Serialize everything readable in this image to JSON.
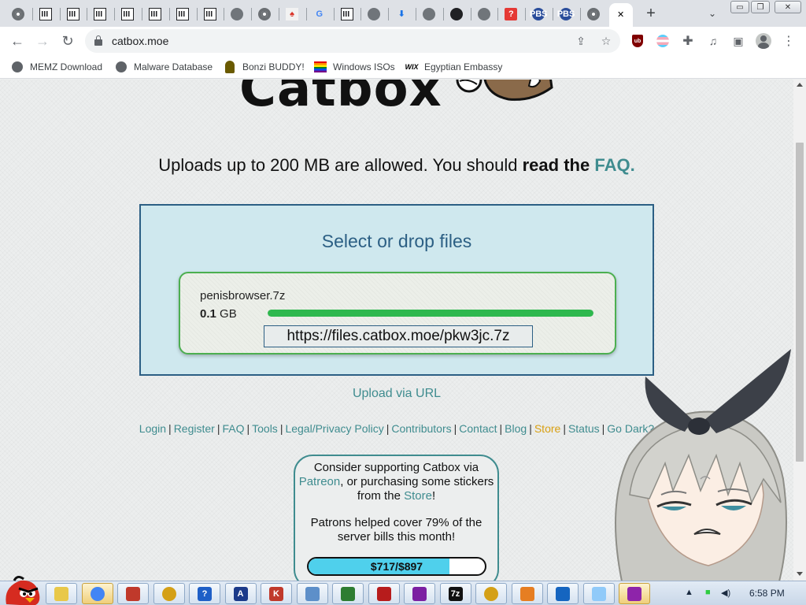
{
  "browser": {
    "tabs": [
      {
        "icon": "chrome-icon"
      },
      {
        "icon": "archive-icon"
      },
      {
        "icon": "archive-icon"
      },
      {
        "icon": "archive-icon"
      },
      {
        "icon": "archive-icon"
      },
      {
        "icon": "archive-icon"
      },
      {
        "icon": "archive-icon"
      },
      {
        "icon": "archive-icon"
      },
      {
        "icon": "globe-icon"
      },
      {
        "icon": "chrome-icon"
      },
      {
        "icon": "red-site-icon"
      },
      {
        "icon": "google-icon"
      },
      {
        "icon": "archive-icon"
      },
      {
        "icon": "globe-icon"
      },
      {
        "icon": "download-icon"
      },
      {
        "icon": "globe-icon"
      },
      {
        "icon": "github-icon"
      },
      {
        "icon": "globe-icon"
      },
      {
        "icon": "red-box-icon"
      },
      {
        "icon": "pbs-icon"
      },
      {
        "icon": "pbs-icon"
      },
      {
        "icon": "chrome-icon"
      },
      {
        "icon": "close-icon",
        "active": true
      }
    ],
    "new_tab_symbol": "+",
    "tab_search_symbol": "⌄",
    "window_controls": {
      "minimize": "▭",
      "maximize": "❐",
      "close": "✕"
    },
    "url": "catbox.moe",
    "bookmarks": [
      {
        "label": "MEMZ Download",
        "icon": "globe-icon"
      },
      {
        "label": "Malware Database",
        "icon": "globe-icon"
      },
      {
        "label": "Bonzi BUDDY!",
        "icon": "bonzi-icon"
      },
      {
        "label": "Windows ISOs",
        "icon": "rainbow-flag-icon"
      },
      {
        "label": "Egyptian Embassy",
        "icon": "wix-icon"
      }
    ],
    "wix_label": "WIX",
    "ublock_label": "ub"
  },
  "page": {
    "logo_text": "Catbox",
    "tagline_pre": "Uploads up to 200 MB are allowed. You should ",
    "tagline_bold": "read the",
    "tagline_link": "FAQ.",
    "upload_title": "Select or drop files",
    "file": {
      "name": "penisbrowser.7z",
      "size_value": "0.1",
      "size_unit": "GB",
      "progress": 1.0,
      "link": "https://files.catbox.moe/pkw3jc.7z"
    },
    "upload_url_label": "Upload via URL",
    "footer_links": [
      "Login",
      "Register",
      "FAQ",
      "Tools",
      "Legal/Privacy Policy",
      "Contributors",
      "Contact",
      "Blog",
      "Store",
      "Status",
      "Go Dark?"
    ],
    "support": {
      "line1_pre": "Consider supporting Catbox via",
      "patreon": "Patreon",
      "line1_mid": ", or purchasing some stickers from the ",
      "store": "Store",
      "line1_end": "!",
      "line2": "Patrons helped cover 79% of the server bills this month!",
      "donate_label": "$717/$897",
      "donate_fraction": 0.8
    }
  },
  "taskbar": {
    "items": [
      {
        "icon": "folder-icon",
        "color": "#e8c84a"
      },
      {
        "icon": "chrome-icon",
        "color": "#4285f4",
        "active": true
      },
      {
        "icon": "solitaire-icon",
        "color": "#c0392b"
      },
      {
        "icon": "disc-icon",
        "color": "#d4a017"
      },
      {
        "icon": "help-icon",
        "color": "#1e5fc7",
        "label": "?"
      },
      {
        "icon": "a-app-icon",
        "color": "#1b3a8a",
        "label": "A"
      },
      {
        "icon": "k-app-icon",
        "color": "#c0392b",
        "label": "K"
      },
      {
        "icon": "network-icon",
        "color": "#5d8fc9"
      },
      {
        "icon": "tree-icon",
        "color": "#2e7d32"
      },
      {
        "icon": "spider-icon",
        "color": "#b71c1c"
      },
      {
        "icon": "media-icon",
        "color": "#7b1fa2"
      },
      {
        "icon": "7zip-icon",
        "color": "#111111",
        "label": "7z"
      },
      {
        "icon": "disc-icon",
        "color": "#d4a017"
      },
      {
        "icon": "paint-icon",
        "color": "#e67e22"
      },
      {
        "icon": "paint-brush-icon",
        "color": "#1565c0"
      },
      {
        "icon": "notepad-icon",
        "color": "#90caf9"
      },
      {
        "icon": "winrar-icon",
        "color": "#8e24aa",
        "active": true
      }
    ],
    "clock": "6:58 PM"
  }
}
